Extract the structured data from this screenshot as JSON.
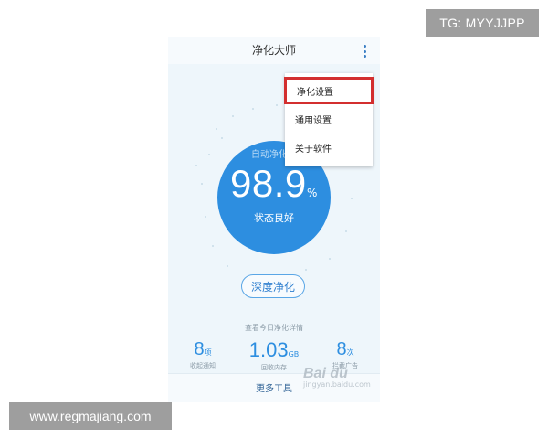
{
  "watermarks": {
    "tg": "TG: MYYJJPP",
    "url": "www.regmajiang.com",
    "baidu_logo": "Bai du",
    "baidu_url": "jingyan.baidu.com"
  },
  "header": {
    "title": "净化大师",
    "menu_icon": "more-vertical-icon"
  },
  "gauge": {
    "mode_label": "自动净化",
    "value": "98.9",
    "unit": "%",
    "status": "状态良好",
    "color": "#2d8ee0"
  },
  "actions": {
    "deep_clean_label": "深度净化",
    "today_details_link": "查看今日净化详情"
  },
  "stats": [
    {
      "value": "8",
      "unit": "项",
      "caption": "收起通知"
    },
    {
      "value": "1.03",
      "unit": "GB",
      "caption": "回收内存"
    },
    {
      "value": "8",
      "unit": "次",
      "caption": "拦截广告"
    }
  ],
  "bottom_bar": {
    "more_tools_label": "更多工具"
  },
  "popup_menu": {
    "items": [
      {
        "label": "净化设置",
        "highlighted": true
      },
      {
        "label": "通用设置",
        "highlighted": false
      },
      {
        "label": "关于软件",
        "highlighted": false
      }
    ],
    "highlight_color": "#d32f2f"
  }
}
